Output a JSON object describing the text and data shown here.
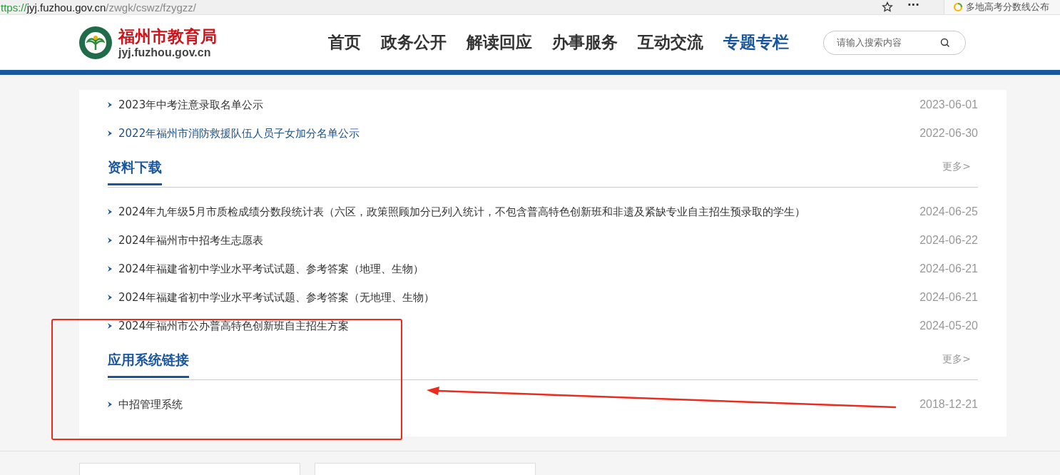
{
  "browser": {
    "url_scheme": "ttps://",
    "url_host": "jyj.fuzhou.gov.cn",
    "url_path": "/zwgk/cswz/fzygzz/",
    "more": "···",
    "tab_title": "多地高考分数线公布"
  },
  "header": {
    "site_name": "福州市教育局",
    "domain": "jyj.fuzhou.gov.cn",
    "nav": [
      {
        "label": "首页",
        "selected": false
      },
      {
        "label": "政务公开",
        "selected": false
      },
      {
        "label": "解读回应",
        "selected": false
      },
      {
        "label": "办事服务",
        "selected": false
      },
      {
        "label": "互动交流",
        "selected": false
      },
      {
        "label": "专题专栏",
        "selected": true
      }
    ],
    "search": {
      "placeholder": "请输入搜索内容"
    }
  },
  "top_rows": [
    {
      "title": "2023年中考注意录取名单公示",
      "date": "2023-06-01",
      "visited": false
    },
    {
      "title": "2022年福州市消防救援队伍人员子女加分名单公示",
      "date": "2022-06-30",
      "visited": true
    }
  ],
  "sections": [
    {
      "title": "资料下载",
      "more": "更多>",
      "rows": [
        {
          "title": "2024年九年级5月市质检成绩分数段统计表（六区，政策照顾加分已列入统计，不包含普高特色创新班和非遗及紧缺专业自主招生预录取的学生）",
          "date": "2024-06-25",
          "visited": false
        },
        {
          "title": "2024年福州市中招考生志愿表",
          "date": "2024-06-22",
          "visited": false
        },
        {
          "title": "2024年福建省初中学业水平考试试题、参考答案（地理、生物）",
          "date": "2024-06-21",
          "visited": false
        },
        {
          "title": "2024年福建省初中学业水平考试试题、参考答案（无地理、生物）",
          "date": "2024-06-21",
          "visited": false
        },
        {
          "title": "2024年福州市公办普高特色创新班自主招生方案",
          "date": "2024-05-20",
          "visited": false
        }
      ]
    },
    {
      "title": "应用系统链接",
      "more": "更多>",
      "rows": [
        {
          "title": "中招管理系统",
          "date": "2018-12-21",
          "visited": false
        }
      ]
    }
  ]
}
